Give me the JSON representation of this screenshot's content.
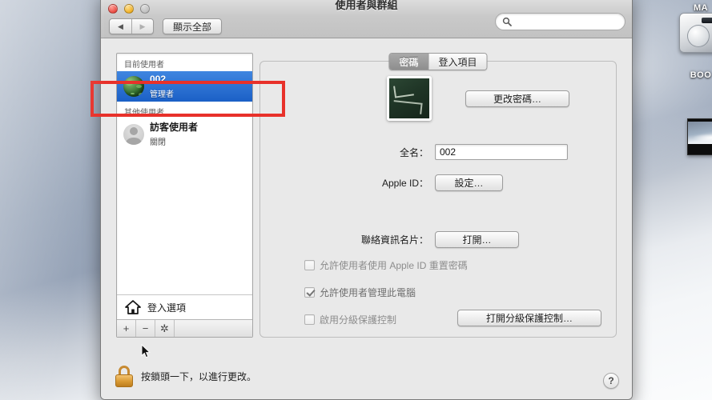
{
  "window": {
    "title": "使用者與群組",
    "traffic_lights": [
      "close",
      "minimize",
      "zoom"
    ],
    "nav_back": "◀",
    "nav_forward": "▶",
    "show_all_label": "顯示全部",
    "search_placeholder": "",
    "search_value": ""
  },
  "sidebar": {
    "current_user_header": "目前使用者",
    "current_user": {
      "name": "002",
      "role": "管理者"
    },
    "other_users_header": "其他使用者",
    "other_users": [
      {
        "name": "訪客使用者",
        "role": "關閉"
      }
    ],
    "login_options_label": "登入選項",
    "toolbar": {
      "add": "+",
      "remove": "−",
      "gear": "✲"
    }
  },
  "tabs": [
    {
      "label": "密碼",
      "active": true
    },
    {
      "label": "登入項目",
      "active": false
    }
  ],
  "main": {
    "change_password_button": "更改密碼…",
    "fullname_label": "全名：",
    "fullname_value": "002",
    "appleid_label": "Apple ID：",
    "appleid_button": "設定…",
    "contacts_label": "聯絡資訊名片：",
    "contacts_button": "打開…",
    "checkbox_reset_password": {
      "label": "允許使用者使用 Apple ID 重置密碼",
      "checked": false
    },
    "checkbox_admin": {
      "label": "允許使用者管理此電腦",
      "checked": true
    },
    "checkbox_parental": {
      "label": "啟用分級保護控制",
      "checked": false
    },
    "parental_button": "打開分級保護控制…"
  },
  "footer": {
    "lock_text": "按鎖頭一下，以進行更改。",
    "help_label": "?"
  },
  "desktop": {
    "icons": [
      {
        "label": "MA",
        "type": "hard-drive"
      },
      {
        "label": "BOO",
        "type": "hard-drive-label"
      },
      {
        "label": "",
        "type": "screenshot-thumbnail"
      }
    ]
  },
  "annotation": {
    "color": "#e8312a"
  }
}
